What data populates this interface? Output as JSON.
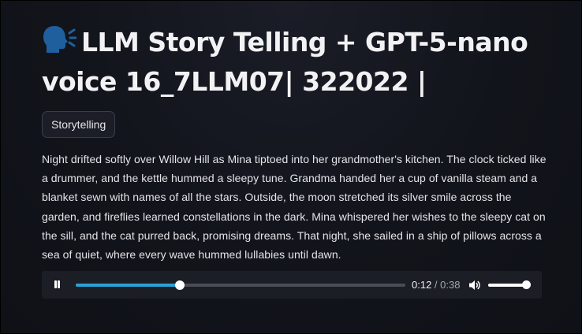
{
  "page": {
    "title": "LLM Story Telling + GPT-5-nano voice 16_7LLM07| 322022 |",
    "title_icon": "speaking-head-icon"
  },
  "tag": {
    "label": "Storytelling"
  },
  "story": {
    "text": "Night drifted softly over Willow Hill as Mina tiptoed into her grandmother's kitchen. The clock ticked like a drummer, and the kettle hummed a sleepy tune. Grandma handed her a cup of vanilla steam and a blanket sewn with names of all the stars. Outside, the moon stretched its silver smile across the garden, and fireflies learned constellations in the dark. Mina whispered her wishes to the sleepy cat on the sill, and the cat purred back, promising dreams. That night, she sailed in a ship of pillows across a sea of quiet, where every wave hummed lullabies until dawn."
  },
  "audio": {
    "state": "playing",
    "control_icon": "pause-icon",
    "current_time": "0:12",
    "separator": " / ",
    "duration": "0:38",
    "progress": 0.316,
    "volume_icon": "volume-icon",
    "volume": 0.88
  },
  "colors": {
    "background": "#0f1117",
    "text": "#e4e4e8",
    "accent": "#29a3d6",
    "tag_bg": "#1c1e27",
    "player_bg": "#1c1e26"
  }
}
